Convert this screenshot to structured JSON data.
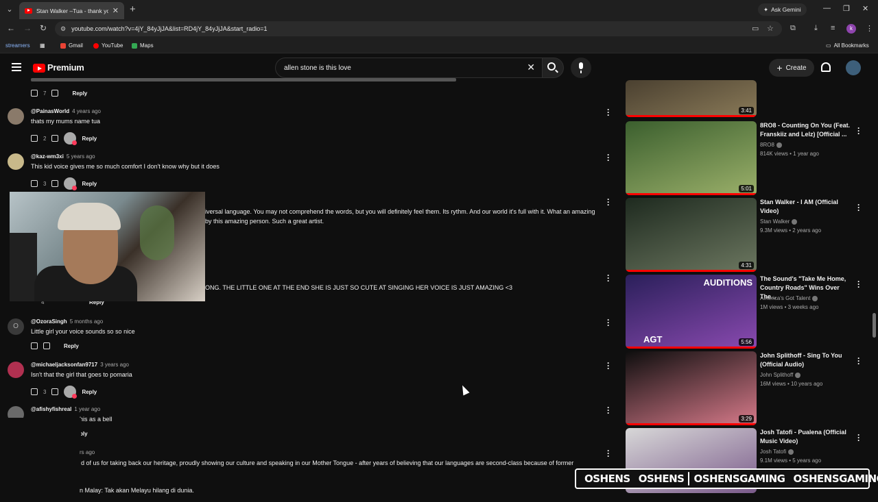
{
  "browser": {
    "tab_title": "Stan Walker –Tua - thank you li",
    "url": "youtube.com/watch?v=4jY_84yJjJA&list=RD4jY_84yJjJA&start_radio=1",
    "ask_gemini": "Ask Gemini",
    "bookmarks": [
      "streamers",
      "Gmail",
      "YouTube",
      "Maps"
    ],
    "all_bookmarks": "All Bookmarks",
    "profile_initial": "k"
  },
  "youtube": {
    "brand": "Premium",
    "search_query": "allen stone is this love",
    "create_label": "Create"
  },
  "comments": [
    {
      "handle": "@PainasWorld",
      "time": "4 years ago",
      "text": "thats my mums name tua",
      "likes": "2"
    },
    {
      "handle": "@kaz-wm3xi",
      "time": "5 years ago",
      "text": "This kid voice gives me so much comfort I don't know why but it does",
      "likes": "3"
    },
    {
      "handle": "@OzoraSingh",
      "time": "5 months ago",
      "text": "Little girl your voice sounds so so nice",
      "likes": ""
    },
    {
      "handle": "@michaeljacksonfan9717",
      "time": "3 years ago",
      "text": "Isn't that the girl that goes to pomaria",
      "likes": "3"
    },
    {
      "handle": "@afishyfishreal",
      "time": "1 year ago",
      "text": "his as a bell",
      "likes": ""
    }
  ],
  "partial_texts": {
    "top_likes": "7",
    "line1": "iversal language. You may not comprehend the words, but you will definitely feel them. Its rythm. And our world it's full with it. What an amazing",
    "line2": "by this amazing person. Such a great artist.",
    "line3": "ONG. THE LITTLE ONE AT THE END SHE IS JUST SO CUTE AT SINGING HER VOICE IS JUST AMAZING <3",
    "likes_hidden": "4",
    "line4": "d of us for taking back our heritage, proudly showing our culture and speaking in our Mother Tongue - after years of believing that our languages are second-class because of former",
    "line5": "n Malay: Tak akan Melayu hilang di dunia.",
    "time_hidden": "rs ago",
    "reply": "Reply",
    "reply_partial": "ply"
  },
  "videos": [
    {
      "title": "",
      "channel": "",
      "meta": "",
      "duration": "3:41",
      "thumb": [
        "#4a4030",
        "#8a7a58"
      ]
    },
    {
      "title": "8RO8 - Counting On You (Feat. Franskiiz and Lelz) [Official ...",
      "channel": "8RO8",
      "meta": "814K views • 1 year ago",
      "duration": "5:01",
      "thumb": [
        "#3b5f2e",
        "#9bb06a"
      ]
    },
    {
      "title": "Stan Walker - I AM (Official Video)",
      "channel": "Stan Walker",
      "meta": "9.3M views • 2 years ago",
      "duration": "4:31",
      "thumb": [
        "#1e2a1f",
        "#6c7760"
      ]
    },
    {
      "title": "The Sound's \"Take Me Home, Country Roads\" Wins Over The...",
      "channel": "America's Got Talent",
      "meta": "1M views • 3 weeks ago",
      "duration": "5:56",
      "thumb": [
        "#2a1f5a",
        "#8a4ab0"
      ],
      "badge": "AUDITIONS",
      "badge2": "AGT"
    },
    {
      "title": "John Splithoff - Sing To You (Official Audio)",
      "channel": "John Splithoff",
      "meta": "16M views • 10 years ago",
      "duration": "3:29",
      "thumb": [
        "#0e0e0e",
        "#d77a8a"
      ]
    },
    {
      "title": "Josh Tatofi - Pualena (Official Music Video)",
      "channel": "Josh Tatofi",
      "meta": "9.1M views • 5 years ago",
      "duration": "",
      "thumb": [
        "#d8d8d8",
        "#7a5a8a"
      ]
    }
  ],
  "social": [
    "OSHENS",
    "OSHENS",
    "OSHENSGAMING",
    "OSHENSGAMING"
  ],
  "colors": {
    "accent": "#ff0000",
    "bg": "#0f0f0f",
    "text": "#f1f1f1",
    "muted": "#aaaaaa"
  }
}
